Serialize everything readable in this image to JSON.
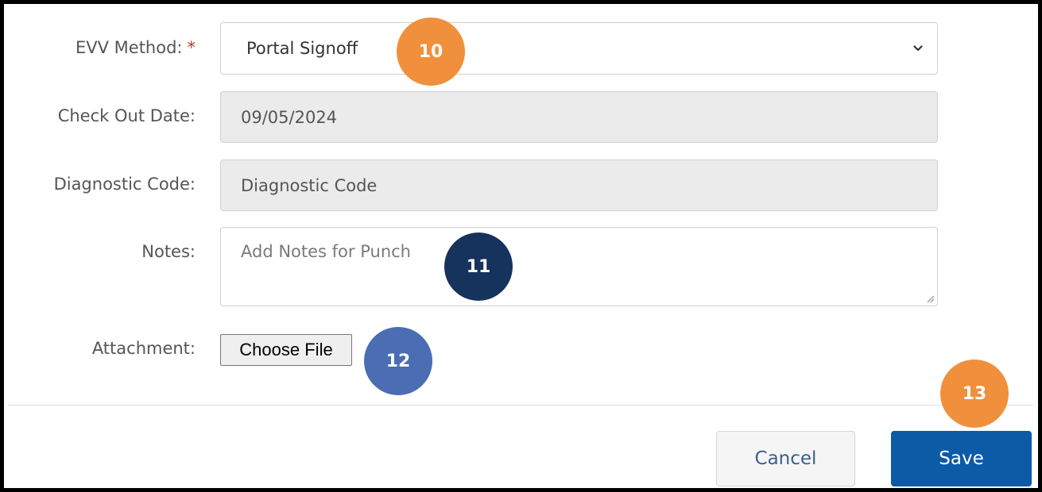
{
  "form": {
    "evv_method": {
      "label": "EVV Method:",
      "required_mark": "*",
      "selected": "Portal Signoff"
    },
    "check_out_date": {
      "label": "Check Out Date:",
      "value": "09/05/2024"
    },
    "diagnostic_code": {
      "label": "Diagnostic Code:",
      "placeholder": "Diagnostic Code"
    },
    "notes": {
      "label": "Notes:",
      "placeholder": "Add Notes for Punch"
    },
    "attachment": {
      "label": "Attachment:",
      "button_label": "Choose File"
    }
  },
  "footer": {
    "cancel_label": "Cancel",
    "save_label": "Save"
  },
  "callouts": [
    {
      "number": "10",
      "color": "#f0903c"
    },
    {
      "number": "11",
      "color": "#16335e"
    },
    {
      "number": "12",
      "color": "#4a6db3"
    },
    {
      "number": "13",
      "color": "#f0903c"
    }
  ],
  "icons": {
    "dropdown": "chevron-down-icon",
    "resize": "resize-grip-icon"
  },
  "colors": {
    "save_button": "#0d5aa7",
    "cancel_text": "#3a5f8a",
    "required": "#c0392b",
    "readonly_field": "#ebebeb"
  }
}
